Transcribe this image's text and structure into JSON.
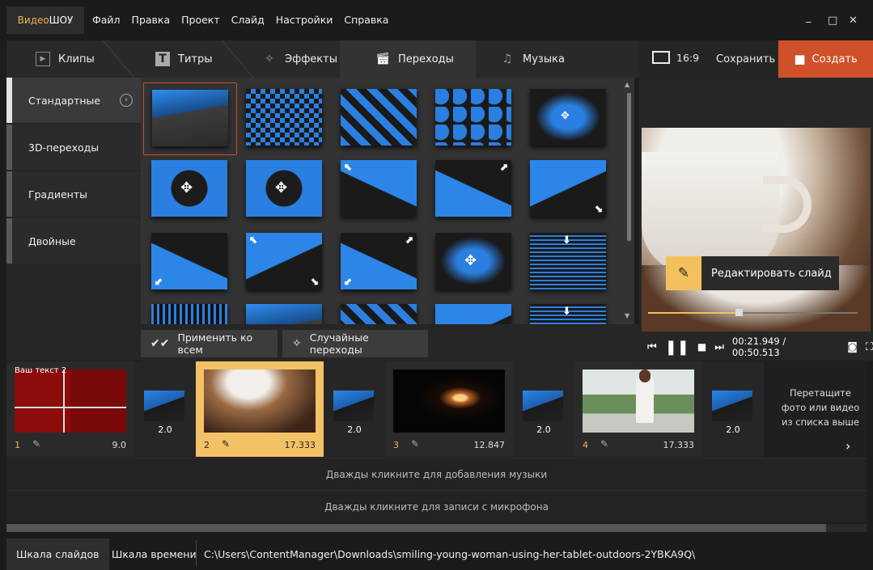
{
  "app": {
    "logo_part1": "Видео",
    "logo_part2": "ШОУ"
  },
  "menu": [
    "Файл",
    "Правка",
    "Проект",
    "Слайд",
    "Настройки",
    "Справка"
  ],
  "window_controls": {
    "minimize": "_",
    "maximize": "□",
    "close": "✕"
  },
  "tabs": [
    {
      "label": "Клипы",
      "icon": "play-icon"
    },
    {
      "label": "Титры",
      "icon": "text-icon"
    },
    {
      "label": "Эффекты",
      "icon": "magic-wand-icon"
    },
    {
      "label": "Переходы",
      "icon": "clapperboard-icon",
      "active": true
    },
    {
      "label": "Музыка",
      "icon": "music-icon"
    }
  ],
  "header_right": {
    "aspect": "16:9",
    "save": "Сохранить",
    "create": "Создать"
  },
  "sidebar": {
    "items": [
      {
        "label": "Стандартные",
        "active": true
      },
      {
        "label": "3D-переходы"
      },
      {
        "label": "Градиенты"
      },
      {
        "label": "Двойные"
      }
    ]
  },
  "grid_buttons": {
    "apply_all": "Применить ко всем",
    "random": "Случайные переходы"
  },
  "preview": {
    "edit_slide": "Редактировать слайд",
    "time_current": "00:21.949",
    "time_total": "00:50.513",
    "progress_fraction": 0.434
  },
  "timeline": {
    "slides": [
      {
        "num": "1",
        "duration": "9.0",
        "overlay_text": "Ваш текст 2"
      },
      {
        "num": "2",
        "duration": "17.333",
        "selected": true
      },
      {
        "num": "3",
        "duration": "12.847"
      },
      {
        "num": "4",
        "duration": "17.333"
      }
    ],
    "transitions": [
      "2.0",
      "2.0",
      "2.0",
      "2.0"
    ],
    "drop_hint": [
      "Перетащите",
      "фото или видео",
      "из списка выше"
    ]
  },
  "tracks": {
    "music": "Дважды кликните для добавления музыки",
    "mic": "Дважды кликните для записи с микрофона"
  },
  "status": {
    "tab_slides": "Шкала слайдов",
    "tab_time": "Шкала времени",
    "path": "C:\\Users\\ContentManager\\Downloads\\smiling-young-woman-using-her-tablet-outdoors-2YBKA9Q\\"
  },
  "colors": {
    "accent_orange": "#d0502a",
    "accent_yellow": "#f3c267",
    "transition_blue": "#2b7fe0"
  }
}
